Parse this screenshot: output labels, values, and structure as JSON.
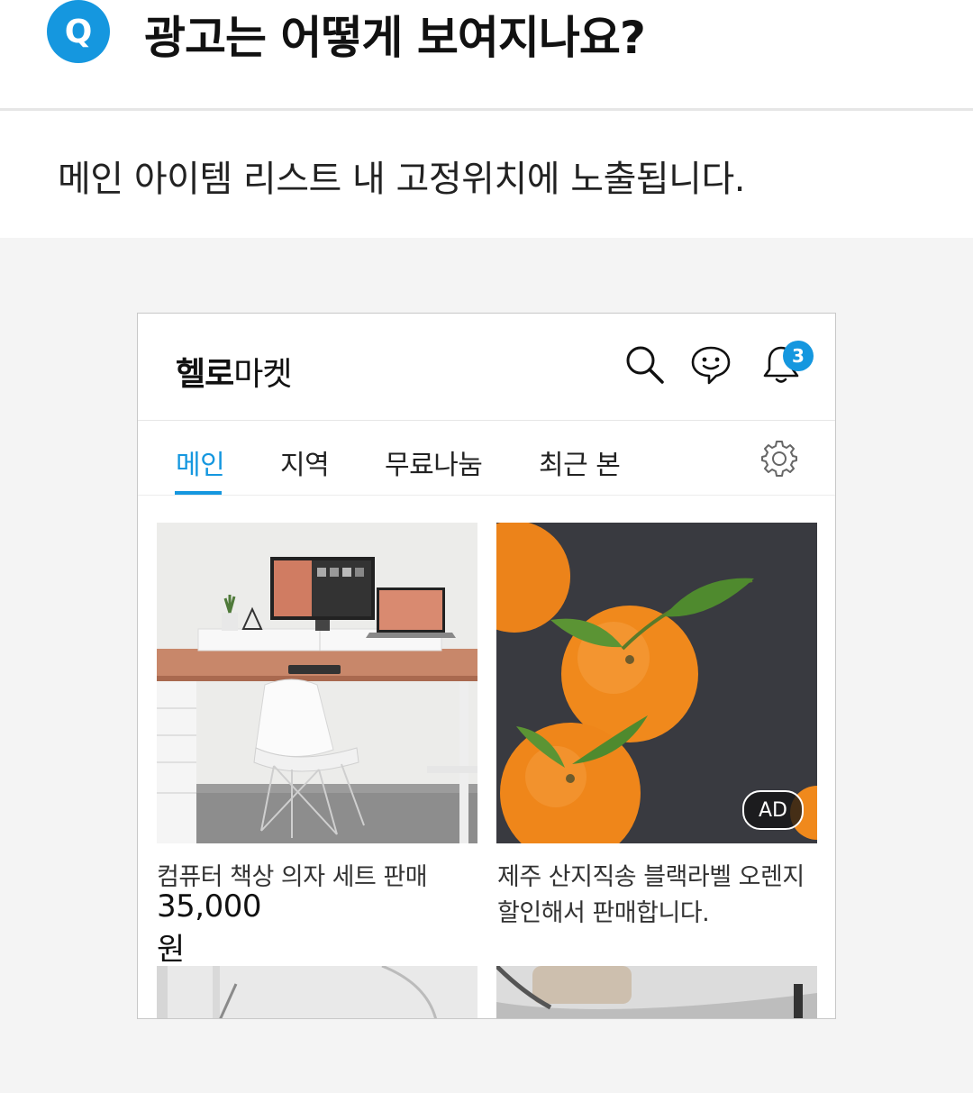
{
  "question": {
    "badge": "Q",
    "title": "광고는 어떻게 보여지나요?"
  },
  "answer": "메인 아이템 리스트 내 고정위치에 노출됩니다.",
  "app": {
    "logo_bold": "헬로",
    "logo_light": "마켓",
    "notification_count": "3",
    "icons": [
      "search-icon",
      "chat-icon",
      "bell-icon",
      "gear-icon"
    ],
    "accent_color": "#1597df",
    "tabs": [
      {
        "label": "메인",
        "active": true
      },
      {
        "label": "지역",
        "active": false
      },
      {
        "label": "무료나눔",
        "active": false
      },
      {
        "label": "최근 본",
        "active": false
      }
    ],
    "items": [
      {
        "title": "컴퓨터 책상 의자 세트 판매",
        "price": "35,000원",
        "ad": false
      },
      {
        "title_line1": "제주 산지직송 블랙라벨 오렌지",
        "title_line2": "할인해서 판매합니다.",
        "ad_label": "AD",
        "ad": true
      }
    ]
  }
}
